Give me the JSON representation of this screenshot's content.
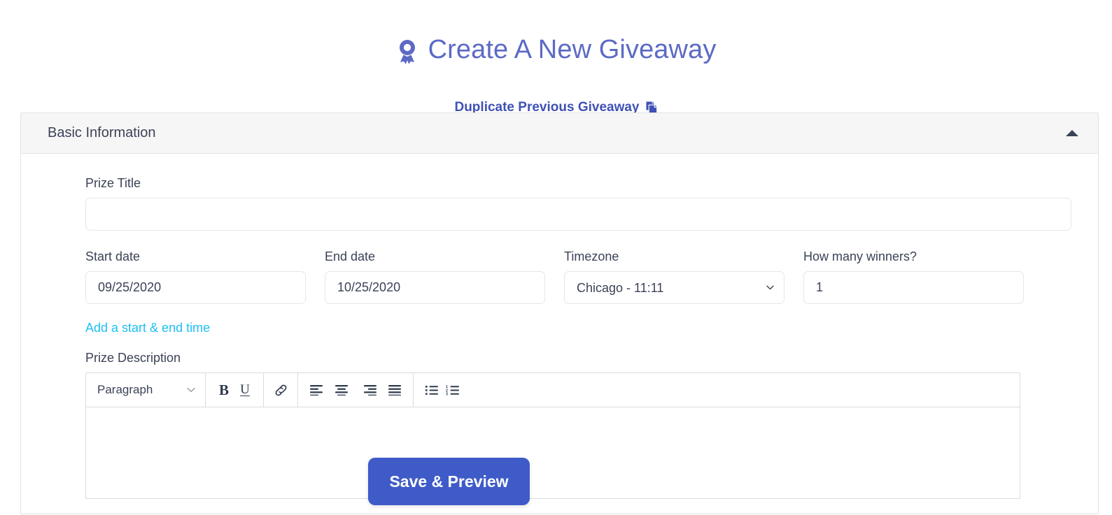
{
  "header": {
    "title": "Create A New Giveaway",
    "title_icon": "award-ribbon-icon",
    "duplicate_link": "Duplicate Previous Giveaway",
    "duplicate_icon": "copy-documents-icon"
  },
  "card": {
    "section_title": "Basic Information",
    "collapse_icon": "caret-up-icon"
  },
  "form": {
    "prize_title": {
      "label": "Prize Title",
      "value": "",
      "placeholder": ""
    },
    "start_date": {
      "label": "Start date",
      "value": "09/25/2020"
    },
    "end_date": {
      "label": "End date",
      "value": "10/25/2020"
    },
    "timezone": {
      "label": "Timezone",
      "value": "Chicago - 11:11",
      "options": [
        "Chicago - 11:11"
      ],
      "chevron_icon": "chevron-down-icon"
    },
    "winners": {
      "label": "How many winners?",
      "value": "1"
    },
    "add_time_link": "Add a start & end time",
    "prize_description": {
      "label": "Prize Description",
      "value": ""
    }
  },
  "editor": {
    "block_format": {
      "value": "Paragraph",
      "chevron_icon": "chevron-down-icon"
    },
    "buttons": [
      {
        "name": "bold",
        "glyph": "B",
        "icon": "bold-icon"
      },
      {
        "name": "underline",
        "glyph": "U",
        "icon": "underline-icon"
      },
      {
        "name": "link",
        "glyph": "",
        "icon": "link-chain-icon"
      },
      {
        "name": "align-left",
        "glyph": "",
        "icon": "align-left-icon"
      },
      {
        "name": "align-center",
        "glyph": "",
        "icon": "align-center-icon"
      },
      {
        "name": "align-right",
        "glyph": "",
        "icon": "align-right-icon"
      },
      {
        "name": "align-justify",
        "glyph": "",
        "icon": "align-justify-icon"
      },
      {
        "name": "bulleted-list",
        "glyph": "",
        "icon": "list-unordered-icon"
      },
      {
        "name": "numbered-list",
        "glyph": "",
        "icon": "list-ordered-icon"
      }
    ]
  },
  "actions": {
    "save_label": "Save & Preview"
  },
  "colors": {
    "brand_purple": "#5c6ac4",
    "link_blue": "#3f51b5",
    "accent_cyan": "#1ec0f3",
    "button_blue": "#3e5bc8",
    "text": "#3c4257"
  }
}
